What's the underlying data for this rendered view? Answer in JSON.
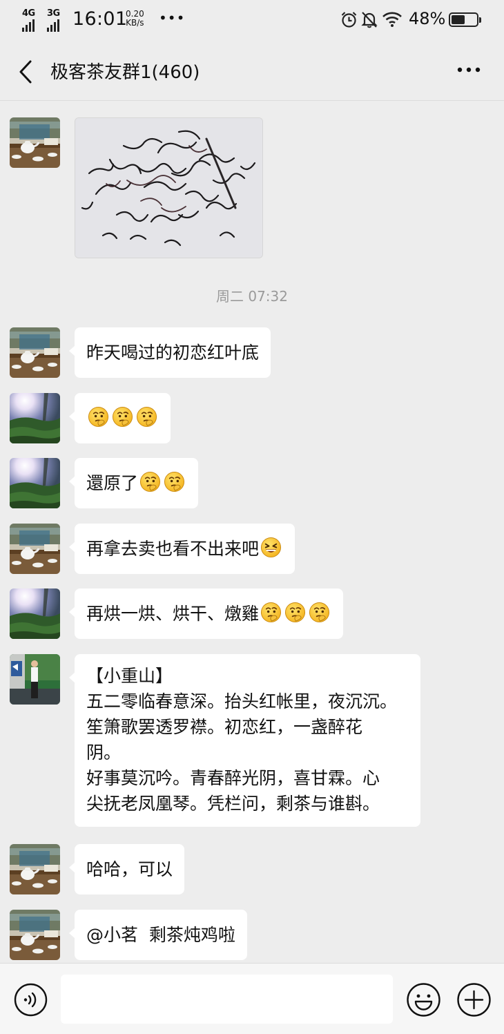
{
  "status_bar": {
    "net1": "4G",
    "net2": "3G",
    "time": "16:01",
    "speed_value": "0.20",
    "speed_unit": "KB/s",
    "battery": "48%",
    "battery_level": 0.48,
    "icons": [
      "alarm-icon",
      "mute-bell-icon",
      "wifi-icon",
      "battery-icon"
    ]
  },
  "header": {
    "title": "极客茶友群1(460)",
    "back_icon": "chevron-left-icon",
    "more_icon": "more-dots-icon"
  },
  "timestamp": "周二 07:32",
  "messages": [
    {
      "avatar": "avatar-tea-set",
      "type": "image"
    },
    {
      "avatar": "avatar-tea-set",
      "text": "昨天喝过的初恋红叶底",
      "emojis": 0
    },
    {
      "avatar": "avatar-tea-field",
      "text": "",
      "emojis": 3
    },
    {
      "avatar": "avatar-tea-field",
      "text": "還原了",
      "emojis": 2
    },
    {
      "avatar": "avatar-tea-set",
      "text": "再拿去卖也看不出来吧",
      "emojis": 1
    },
    {
      "avatar": "avatar-tea-field",
      "text": "再烘一烘、烘干、燉雞",
      "emojis": 3
    },
    {
      "avatar": "avatar-person",
      "lines": [
        "【小重山】",
        "五二零临春意深。抬头红帐里，夜沉沉。",
        "笙箫歌罢透罗襟。初恋红，一盏醉花",
        "阴。",
        "好事莫沉吟。青春醉光阴，喜甘霖。心",
        "尖抚老凤凰琴。凭栏问，剩茶与谁斟。"
      ]
    },
    {
      "avatar": "avatar-tea-set",
      "text": "哈哈，可以",
      "emojis": 0
    },
    {
      "avatar": "avatar-tea-set",
      "text": "@小茗  剩茶炖鸡啦",
      "emojis": 0
    }
  ],
  "input_bar": {
    "voice_icon": "voice-icon",
    "emoji_icon": "emoji-icon",
    "plus_icon": "plus-icon",
    "input_value": ""
  }
}
